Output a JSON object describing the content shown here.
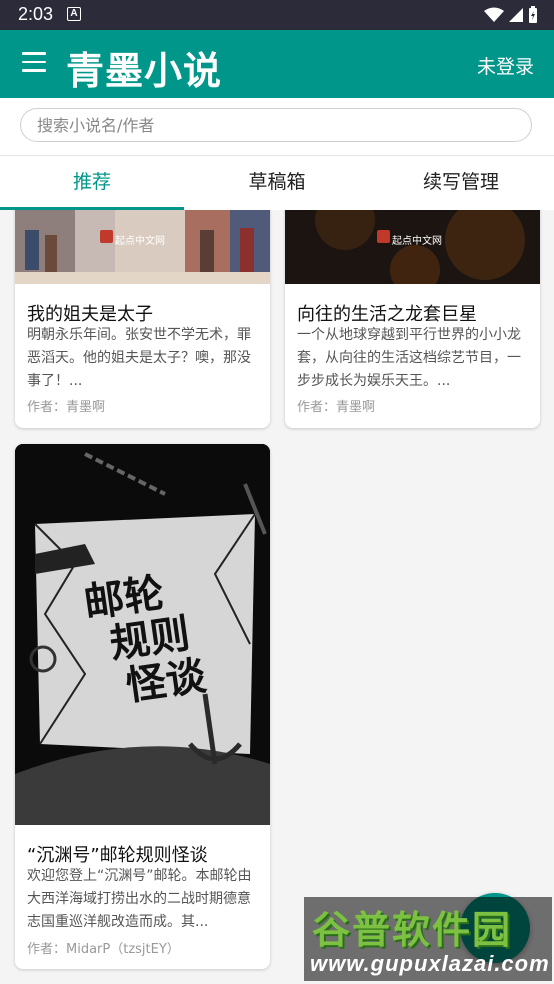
{
  "status_bar": {
    "time": "2:03",
    "notification_icon_letter": "A"
  },
  "app_bar": {
    "title": "青墨小说",
    "login_label": "未登录",
    "color": "#00978a"
  },
  "search": {
    "placeholder": "搜索小说名/作者",
    "value": ""
  },
  "tabs": [
    {
      "label": "推荐",
      "active": true
    },
    {
      "label": "草稿箱",
      "active": false
    },
    {
      "label": "续写管理",
      "active": false
    }
  ],
  "books": [
    {
      "title": "我的姐夫是太子",
      "description": "明朝永乐年间。张安世不学无术，罪恶滔天。他的姐夫是太子？噢，那没事了！...",
      "author": "作者：青墨啊",
      "cover_badge": "起点中文网"
    },
    {
      "title": "向往的生活之龙套巨星",
      "description": "一个从地球穿越到平行世界的小小龙套，从向往的生活这档综艺节目，一步步成长为娱乐天王。...",
      "author": "作者：青墨啊",
      "cover_badge": "起点中文网"
    },
    {
      "title": "“沉渊号”邮轮规则怪谈",
      "description": "欢迎您登上“沉渊号”邮轮。本邮轮由大西洋海域打捞出水的二战时期德意志国重巡洋舰改造而成。其...",
      "author": "作者：MidarP（tzsjtEY）",
      "cover_text_line1": "邮轮",
      "cover_text_line2": "规则",
      "cover_text_line3": "怪谈"
    }
  ],
  "watermark": {
    "text": "谷普软件园",
    "url": "www.gupuxlazai.com"
  }
}
